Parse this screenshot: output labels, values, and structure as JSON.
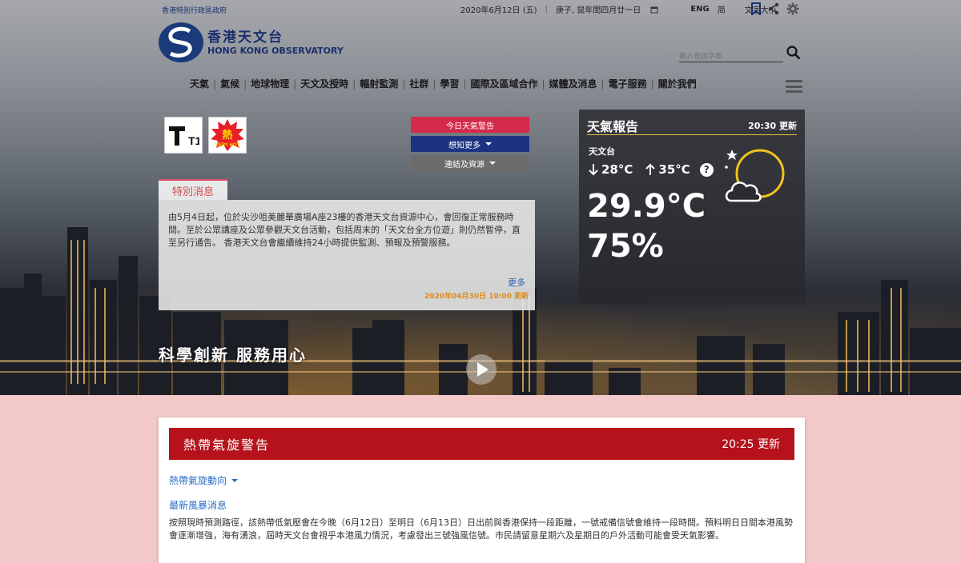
{
  "header": {
    "gov_label": "香港特別行政區政府",
    "date": "2020年6月12日 (五)",
    "lunar": "庚子, 鼠年閏四月廿一日",
    "lang_eng": "ENG",
    "lang_sc": "简",
    "font_size": "文字大小",
    "logo_zh": "香港天文台",
    "logo_en": "HONG KONG OBSERVATORY",
    "search_placeholder": "輸入查詢字串"
  },
  "nav": [
    "天氣",
    "氣候",
    "地球物理",
    "天文及授時",
    "輻射監測",
    "社群",
    "學習",
    "國際及區域合作",
    "媒體及消息",
    "電子服務",
    "關於我們"
  ],
  "signals": {
    "t1_label": "T1",
    "hot_zh": "熱",
    "hot_en": "VERY HOT"
  },
  "buttons": {
    "warning": "今日天氣警告",
    "more": "想知更多",
    "links": "連結及資源"
  },
  "notice": {
    "tab": "特別消息",
    "body": "由5月4日起，位於尖沙咀美麗華廣場A座23樓的香港天文台資源中心，會回復正常服務時間。至於公眾講座及公眾參觀天文台活動，包括周末的「天文台全方位遊」則仍然暫停，直至另行通告。 香港天文台會繼續維持24小時提供監測、預報及預警服務。",
    "more": "更多",
    "date": "2020年04月30日 10:00 更新"
  },
  "slogan": "科學創新 服務用心",
  "weather": {
    "title": "天氣報告",
    "updated": "20:30 更新",
    "station": "天文台",
    "min": "28°C",
    "max": "35°C",
    "temp": "29.9°C",
    "humidity": "75%"
  },
  "typhoon": {
    "title": "熱帶氣旋警告",
    "updated": "20:25 更新",
    "track_link": "熱帶氣旋動向",
    "news_link": "最新風暴消息",
    "text": "按照現時預測路徑，該熱帶低氣壓會在今晚（6月12日）至明日（6月13日）日出前與香港保持一段距離，一號戒備信號會維持一段時間。預料明日日間本港風勢會逐漸增強，海有湧浪，屆時天文台會視乎本港風力情況，考慮發出三號強風信號。市民請留意星期六及星期日的戶外活動可能會受天氣影響。"
  },
  "colors": {
    "brand_blue": "#1a2f6b",
    "alert_red": "#b5121b",
    "warning_pink": "#d42a4b",
    "accent_yellow": "#e8c43a"
  }
}
